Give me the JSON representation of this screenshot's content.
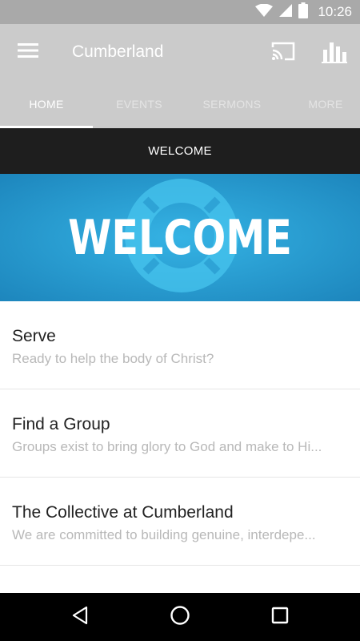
{
  "status_bar": {
    "time": "10:26",
    "icons": [
      "wifi-icon",
      "cell-signal-icon",
      "battery-icon"
    ]
  },
  "app_bar": {
    "title": "Cumberland",
    "icons": [
      "menu-icon",
      "cast-icon",
      "bar-chart-icon"
    ]
  },
  "tabs": [
    {
      "label": "HOME",
      "active": true
    },
    {
      "label": "EVENTS",
      "active": false
    },
    {
      "label": "SERMONS",
      "active": false
    },
    {
      "label": "MORE",
      "active": false
    }
  ],
  "section_header": {
    "title": "WELCOME"
  },
  "banner": {
    "text": "WELCOME",
    "background_color": "#2a9ed2",
    "ring_color": "#3bbde8"
  },
  "list": [
    {
      "title": "Serve",
      "subtitle": "Ready to help the body of Christ?"
    },
    {
      "title": "Find a Group",
      "subtitle": "Groups exist to bring glory to God and make to Hi..."
    },
    {
      "title": "The Collective at Cumberland",
      "subtitle": "We are committed to building genuine, interdepe..."
    }
  ],
  "nav_bar": {
    "icons": [
      "back-icon",
      "home-icon",
      "recents-icon"
    ]
  },
  "colors": {
    "app_bar": "#cbcbcb",
    "status_bar": "#a9a9a9",
    "section_header": "#1e1e1e"
  }
}
